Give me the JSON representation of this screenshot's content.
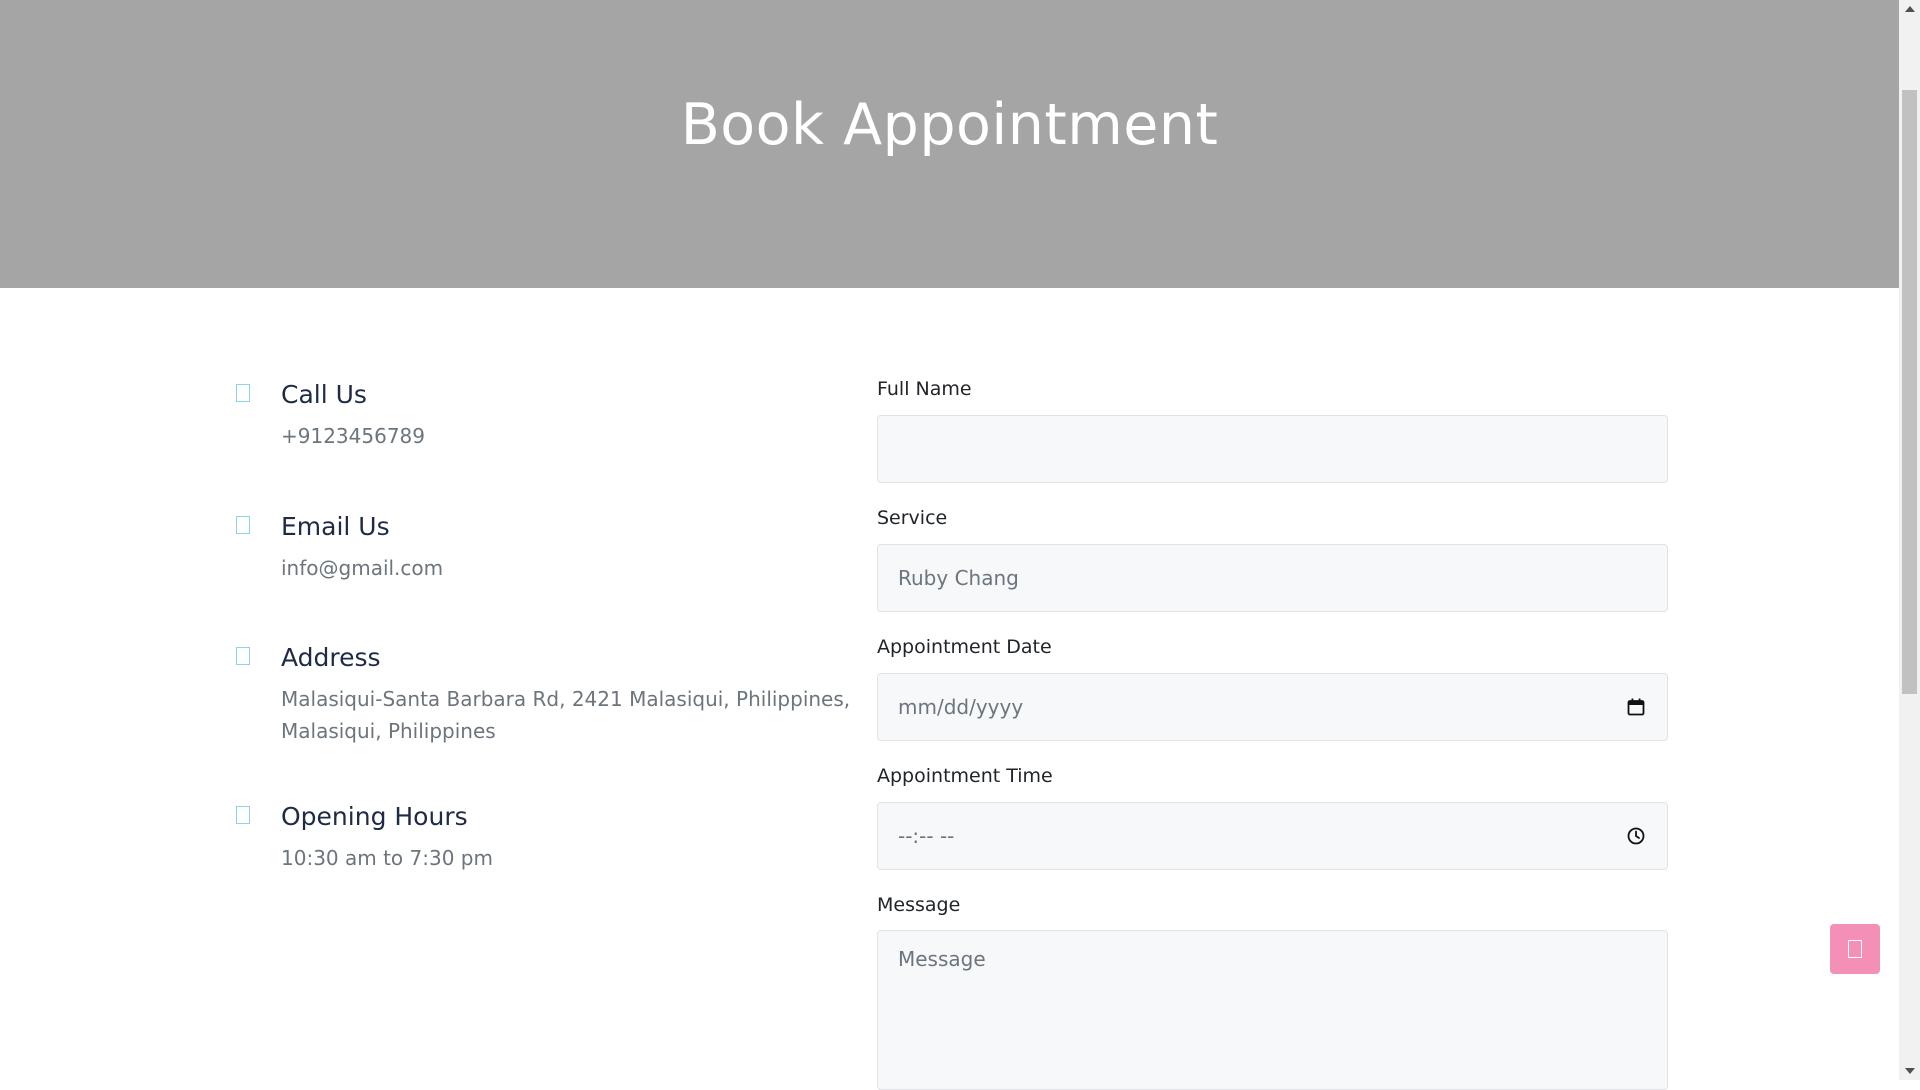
{
  "hero": {
    "title": "Book Appointment"
  },
  "contact": [
    {
      "icon": "phone-icon",
      "title": "Call Us",
      "value": "+9123456789"
    },
    {
      "icon": "email-icon",
      "title": "Email Us",
      "value": "info@gmail.com"
    },
    {
      "icon": "location-icon",
      "title": "Address",
      "value": "Malasiqui-Santa Barbara Rd, 2421 Malasiqui, Philippines, Malasiqui, Philippines"
    },
    {
      "icon": "clock-icon",
      "title": "Opening Hours",
      "value": "10:30 am to 7:30 pm"
    }
  ],
  "form": {
    "full_name": {
      "label": "Full Name",
      "value": "",
      "placeholder": ""
    },
    "service": {
      "label": "Service",
      "value": "",
      "placeholder": "Ruby Chang"
    },
    "date": {
      "label": "Appointment Date",
      "placeholder": "mm/dd/yyyy"
    },
    "time": {
      "label": "Appointment Time",
      "placeholder": "--:-- --"
    },
    "message": {
      "label": "Message",
      "value": "",
      "placeholder": "Message"
    }
  },
  "colors": {
    "hero_bg": "#a5a5a5",
    "accent_icon": "#8fd3e8",
    "back_to_top_bg": "#f48fb8",
    "field_bg": "#f7f8fa"
  }
}
